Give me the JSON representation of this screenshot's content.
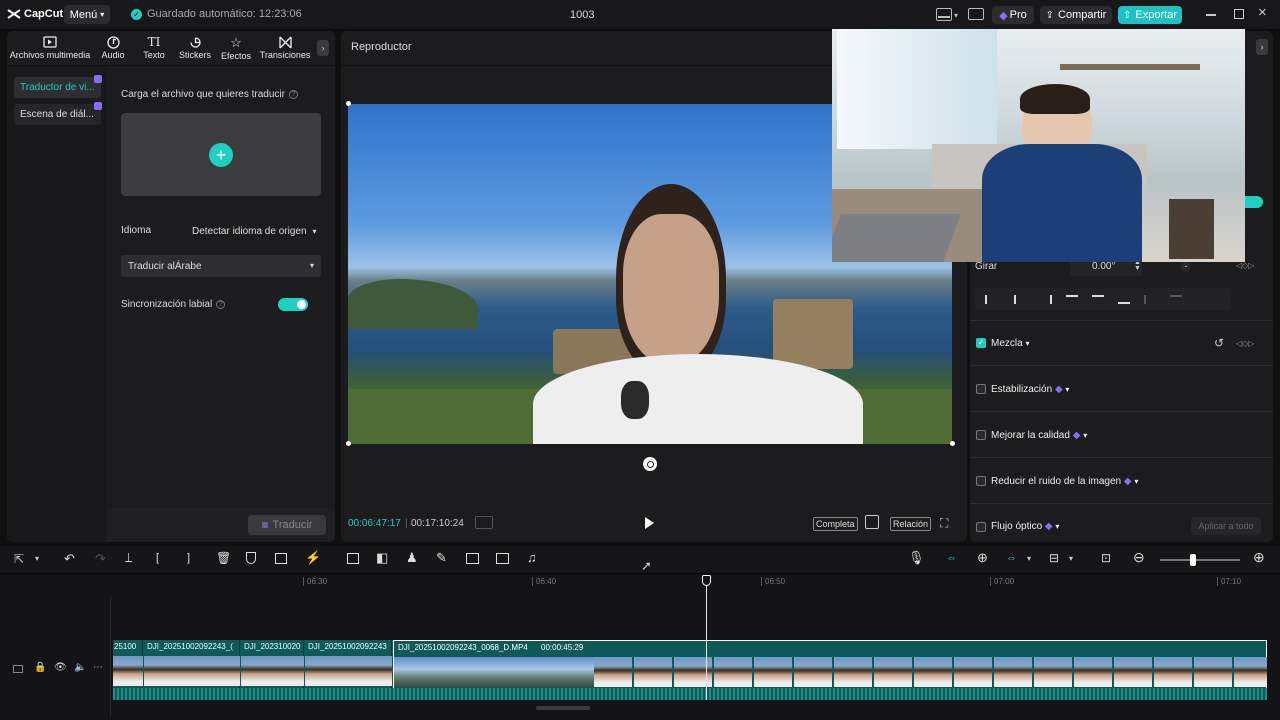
{
  "titlebar": {
    "logo": "CapCut",
    "menu": "Menú",
    "autosave": "Guardado automático: 12:23:06",
    "project": "1003",
    "pro": "Pro",
    "share": "Compartir",
    "export": "Exportar"
  },
  "toolbar": {
    "items": [
      {
        "label": "Archivos multimedia",
        "icon": "media-icon"
      },
      {
        "label": "Audio",
        "icon": "audio-icon"
      },
      {
        "label": "Texto",
        "icon": "text-icon"
      },
      {
        "label": "Stickers",
        "icon": "sticker-icon"
      },
      {
        "label": "Efectos",
        "icon": "effects-icon"
      },
      {
        "label": "Transiciones",
        "icon": "transitions-icon"
      }
    ]
  },
  "left": {
    "nav": [
      "Traductor de vi...",
      "Escena de diál..."
    ],
    "upload_label": "Carga el archivo que quieres traducir",
    "language_label": "Idioma",
    "language_value": "Detectar idioma de origen",
    "translate_to": "Traducir alÁrabe",
    "lipsync_label": "Sincronización labial",
    "translate_button": "Traducir"
  },
  "player": {
    "title": "Reproductor",
    "current_time": "00:06:47:17",
    "total_time": "00:17:10:24",
    "full": "Completa",
    "ratio": "Relación"
  },
  "right": {
    "rotate_label": "Girar",
    "rotate_value": "0.00°",
    "rotate_minus": "-",
    "blend": "Mezcla",
    "stabilization": "Estabilización",
    "improve_quality": "Mejorar la calidad",
    "reduce_noise": "Reducir el ruido de la imagen",
    "optical_flow": "Flujo óptico",
    "apply_all": "Aplicar a todo"
  },
  "timeline": {
    "ruler": [
      "06:30",
      "06:40",
      "06:50",
      "07:00",
      "07:10"
    ],
    "clips": [
      {
        "label": "25100"
      },
      {
        "label": "DJI_20251002092243_("
      },
      {
        "label": "DJI_202310020"
      },
      {
        "label": "DJI_20251002092243"
      },
      {
        "label": "DJI_20251002092243_0068_D.MP4",
        "duration": "00:00:45:29"
      }
    ]
  },
  "colors": {
    "accent": "#1fcfc1",
    "pro_purple": "#8b6cf6",
    "panel": "#1c1c1e",
    "background": "#0f0f10"
  }
}
